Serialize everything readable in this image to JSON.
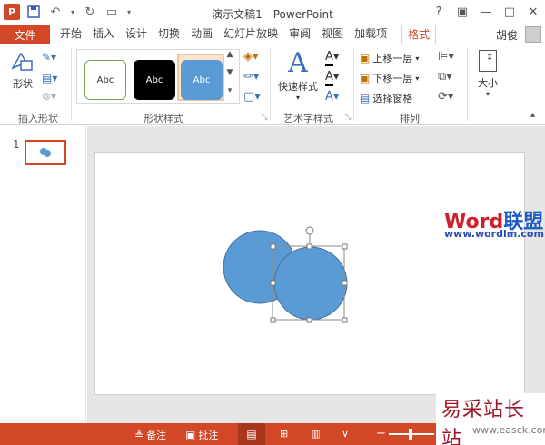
{
  "window": {
    "title": "演示文稿1 - PowerPoint",
    "app_icon": "P",
    "help": "?",
    "accent": "#d24726"
  },
  "tabs": {
    "file": "文件",
    "items": [
      "开始",
      "插入",
      "设计",
      "切换",
      "动画",
      "幻灯片放映",
      "审阅",
      "视图",
      "加载项",
      "格式"
    ],
    "active": "格式",
    "user": "胡俊"
  },
  "ribbon": {
    "insert_shapes": {
      "shape_btn": "形状",
      "label": "插入形状"
    },
    "shape_styles": {
      "samples": [
        "Abc",
        "Abc",
        "Abc"
      ],
      "label": "形状样式"
    },
    "wordart": {
      "quick_styles": "快速样式",
      "label": "艺术字样式"
    },
    "arrange": {
      "bring_forward": "上移一层",
      "send_backward": "下移一层",
      "selection_pane": "选择窗格",
      "label": "排列"
    },
    "size": {
      "label": "大小"
    }
  },
  "slide_pane": {
    "number": "1"
  },
  "watermark": {
    "word_logo_a": "Word",
    "word_logo_b": "联盟",
    "word_url": "www.wordlm.com",
    "corner_cn": "易采站长站",
    "corner_url": "www.easck.com"
  },
  "status": {
    "notes": "备注",
    "comments": "批注"
  },
  "colors": {
    "shape_fill": "#5b9bd5",
    "shape_line": "#41719c"
  }
}
